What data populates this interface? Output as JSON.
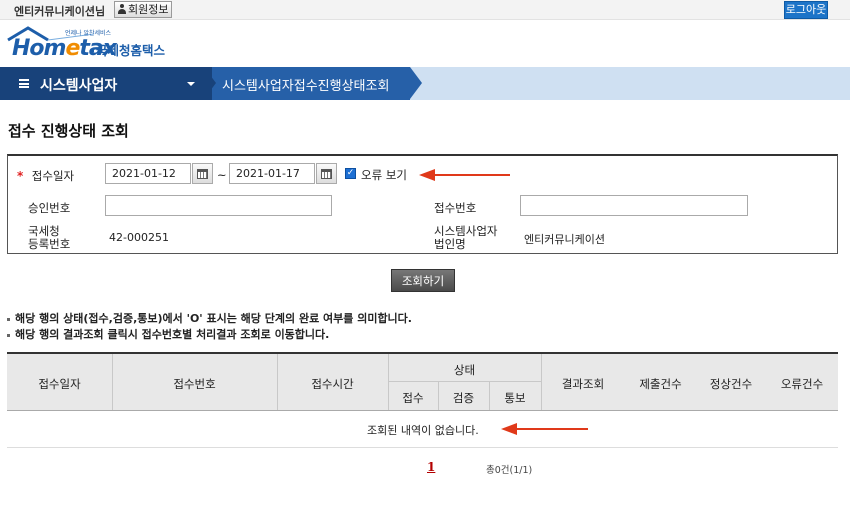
{
  "header": {
    "username": "엔티커뮤니케이션님",
    "member_info_label": "회원정보",
    "logout_label": "로그아웃"
  },
  "logo": {
    "brand_home": "Hom",
    "brand_e": "e",
    "brand_tax": "tax",
    "tagline": "언제나 알찬세비스",
    "org_name": "국세청홈택스"
  },
  "nav": {
    "section_title": "시스템사업자",
    "page_name": "시스템사업자접수진행상태조회"
  },
  "page_title": "접수 진행상태 조회",
  "search": {
    "receipt_date_label": "접수일자",
    "date_from": "2021-01-12",
    "date_to": "2021-01-17",
    "tilde": "~",
    "error_view_label": "오류 보기",
    "error_view_checked": true,
    "approval_no_label": "승인번호",
    "approval_no_value": "",
    "receipt_no_label": "접수번호",
    "receipt_no_value": "",
    "nts_reg_label_1": "국세청",
    "nts_reg_label_2": "등록번호",
    "nts_reg_value": "42-000251",
    "sys_biz_label_1": "시스템사업자",
    "sys_biz_label_2": "법인명",
    "sys_biz_value": "엔티커뮤니케이션",
    "search_button": "조회하기"
  },
  "notes": [
    "해당 행의 상태(접수,검증,통보)에서 'O' 표시는 해당 단계의 완료 여부를 의미합니다.",
    "해당 행의 결과조회 클릭시 접수번호별 처리결과 조회로 이동합니다."
  ],
  "table": {
    "headers": {
      "receipt_date": "접수일자",
      "receipt_no": "접수번호",
      "receipt_time": "접수시간",
      "status": "상태",
      "status_receipt": "접수",
      "status_verify": "검증",
      "status_notify": "통보",
      "result_view": "결과조회",
      "submit_count": "제출건수",
      "normal_count": "정상건수",
      "error_count": "오류건수"
    },
    "empty_message": "조회된 내역이 없습니다."
  },
  "pagination": {
    "current_page": "1",
    "total_text": "총0건(1/1)"
  },
  "colors": {
    "nav_dark": "#18427a",
    "nav_mid": "#2660a8",
    "annotation_arrow": "#e0391a",
    "logout_blue": "#1d74c8"
  }
}
